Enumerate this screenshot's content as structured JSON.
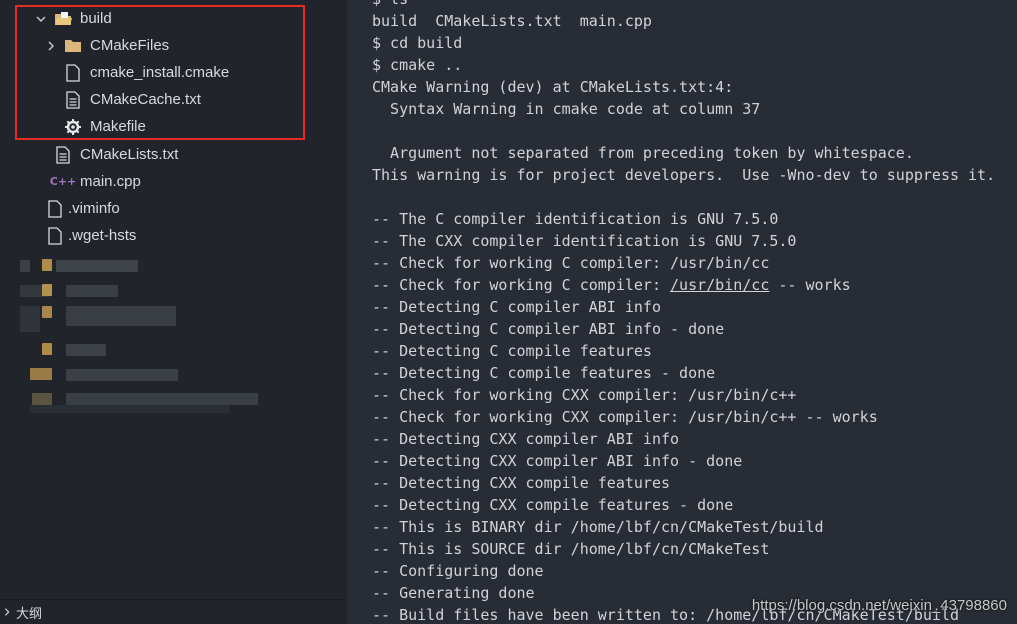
{
  "explorer": {
    "items": [
      {
        "label": "build",
        "kind": "folder-open",
        "expanded": true
      },
      {
        "label": "CMakeFiles",
        "kind": "folder",
        "expanded": false
      },
      {
        "label": "cmake_install.cmake",
        "kind": "file"
      },
      {
        "label": "CMakeCache.txt",
        "kind": "text-file"
      },
      {
        "label": "Makefile",
        "kind": "makefile"
      },
      {
        "label": "CMakeLists.txt",
        "kind": "text-file"
      },
      {
        "label": "main.cpp",
        "kind": "cpp-file"
      },
      {
        "label": ".viminfo",
        "kind": "file"
      },
      {
        "label": ".wget-hsts",
        "kind": "file"
      }
    ],
    "outline_label": "大纲"
  },
  "terminal": {
    "lines": [
      "$ ls",
      "build  CMakeLists.txt  main.cpp",
      "$ cd build",
      "$ cmake ..",
      "CMake Warning (dev) at CMakeLists.txt:4:",
      "  Syntax Warning in cmake code at column 37",
      "",
      "  Argument not separated from preceding token by whitespace.",
      "This warning is for project developers.  Use -Wno-dev to suppress it.",
      "",
      "-- The C compiler identification is GNU 7.5.0",
      "-- The CXX compiler identification is GNU 7.5.0",
      "-- Check for working C compiler: /usr/bin/cc",
      "-- Check for working C compiler: /usr/bin/cc -- works",
      "-- Detecting C compiler ABI info",
      "-- Detecting C compiler ABI info - done",
      "-- Detecting C compile features",
      "-- Detecting C compile features - done",
      "-- Check for working CXX compiler: /usr/bin/c++",
      "-- Check for working CXX compiler: /usr/bin/c++ -- works",
      "-- Detecting CXX compiler ABI info",
      "-- Detecting CXX compiler ABI info - done",
      "-- Detecting CXX compile features",
      "-- Detecting CXX compile features - done",
      "-- This is BINARY dir /home/lbf/cn/CMakeTest/build",
      "-- This is SOURCE dir /home/lbf/cn/CMakeTest",
      "-- Configuring done",
      "-- Generating done",
      "-- Build files have been written to: /home/lbf/cn/CMakeTest/build"
    ],
    "underlined_path": "/usr/bin/cc",
    "watermark": "https://blog.csdn.net/weixin_43798860"
  },
  "colors": {
    "highlight_box": "#e52b26",
    "folder": "#dcb67a",
    "cpp_icon": "#a074c4"
  }
}
